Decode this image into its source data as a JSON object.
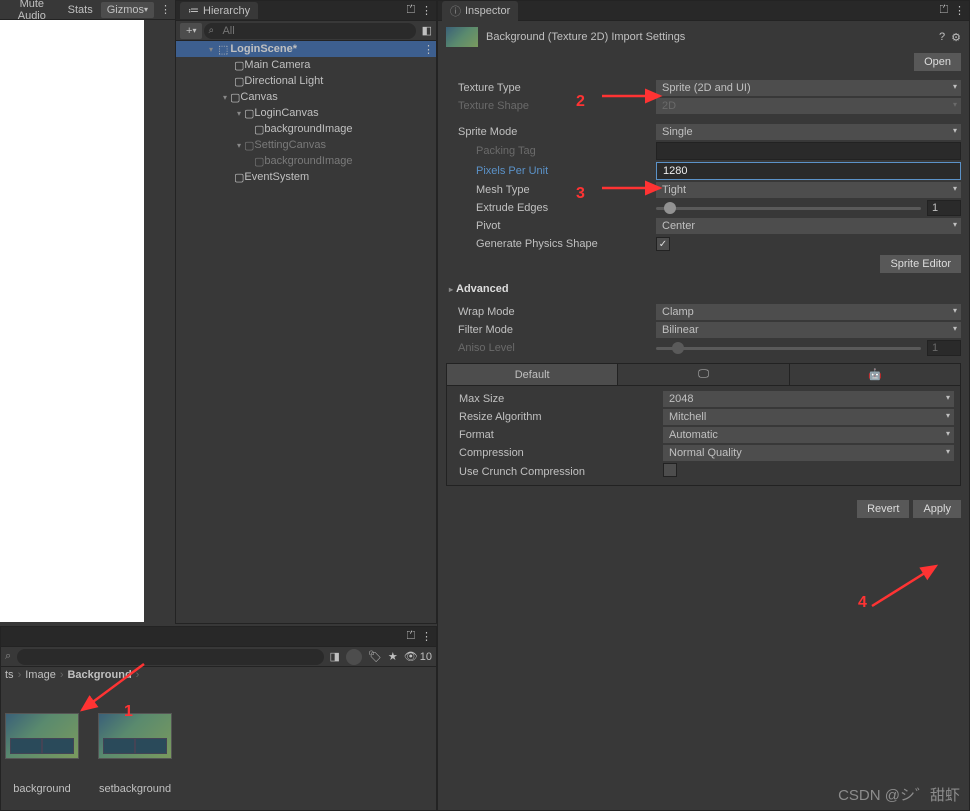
{
  "toolbar_left": {
    "mute": "Mute Audio",
    "stats": "Stats",
    "gizmos": "Gizmos"
  },
  "hierarchy": {
    "tab": "Hierarchy",
    "search_ph": "All",
    "scene": "LoginScene*",
    "items": {
      "main_camera": "Main Camera",
      "dir_light": "Directional Light",
      "canvas": "Canvas",
      "login_canvas": "LoginCanvas",
      "bg_image1": "backgroundImage",
      "setting_canvas": "SettingCanvas",
      "bg_image2": "backgroundImage",
      "event_system": "EventSystem"
    }
  },
  "inspector": {
    "tab": "Inspector",
    "title": "Background (Texture 2D) Import Settings",
    "open": "Open",
    "texture_type_lbl": "Texture Type",
    "texture_type_val": "Sprite (2D and UI)",
    "texture_shape_lbl": "Texture Shape",
    "texture_shape_val": "2D",
    "sprite_mode_lbl": "Sprite Mode",
    "sprite_mode_val": "Single",
    "packing_tag_lbl": "Packing Tag",
    "ppu_lbl": "Pixels Per Unit",
    "ppu_val": "1280",
    "mesh_type_lbl": "Mesh Type",
    "mesh_type_val": "Tight",
    "extrude_lbl": "Extrude Edges",
    "extrude_val": "1",
    "pivot_lbl": "Pivot",
    "pivot_val": "Center",
    "gen_phys_lbl": "Generate Physics Shape",
    "sprite_editor": "Sprite Editor",
    "advanced": "Advanced",
    "wrap_lbl": "Wrap Mode",
    "wrap_val": "Clamp",
    "filter_lbl": "Filter Mode",
    "filter_val": "Bilinear",
    "aniso_lbl": "Aniso Level",
    "aniso_val": "1",
    "default_tab": "Default",
    "max_size_lbl": "Max Size",
    "max_size_val": "2048",
    "resize_lbl": "Resize Algorithm",
    "resize_val": "Mitchell",
    "format_lbl": "Format",
    "format_val": "Automatic",
    "compression_lbl": "Compression",
    "compression_val": "Normal Quality",
    "crunch_lbl": "Use Crunch Compression",
    "revert": "Revert",
    "apply": "Apply"
  },
  "project": {
    "count": "10",
    "crumb1": "ts",
    "crumb2": "Image",
    "crumb3": "Background",
    "thumb1": "background",
    "thumb2": "setbackground"
  },
  "annotations": {
    "a1": "1",
    "a2": "2",
    "a3": "3",
    "a4": "4"
  },
  "watermark": "CSDN @シ゛甜虾"
}
